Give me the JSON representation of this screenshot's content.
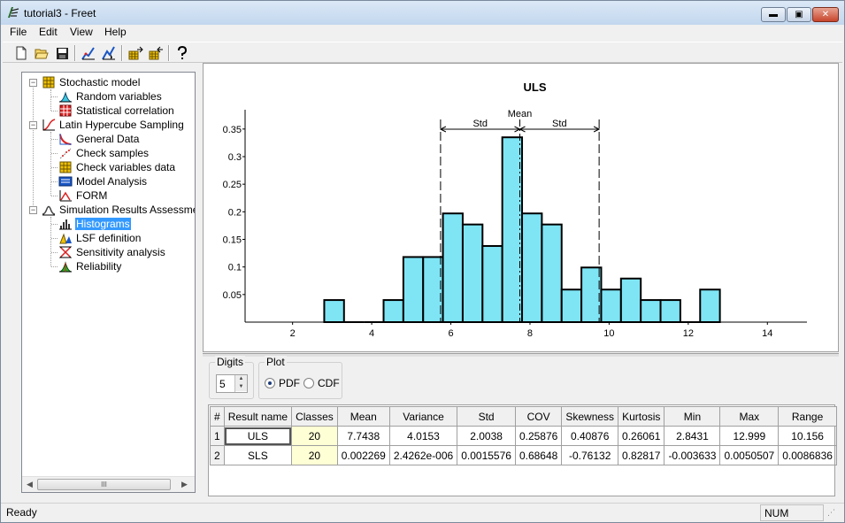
{
  "window": {
    "title": "tutorial3 - Freet",
    "minimize_glyph": "▬",
    "maximize_glyph": "▣",
    "close_glyph": "✕"
  },
  "menu": [
    "File",
    "Edit",
    "View",
    "Help"
  ],
  "toolbar": {
    "icons": [
      "new-file-icon",
      "open-folder-icon",
      "save-icon",
      "chart-up-icon",
      "chart-cursor-icon",
      "grid-export-icon",
      "grid-import-icon",
      "help-icon"
    ]
  },
  "tree": {
    "items": [
      {
        "label": "Stochastic model",
        "level": 0,
        "icon": "stochastic-model-icon",
        "expanded": true
      },
      {
        "label": "Random variables",
        "level": 1,
        "icon": "random-variables-icon"
      },
      {
        "label": "Statistical correlation",
        "level": 1,
        "icon": "correlation-matrix-icon"
      },
      {
        "label": "Latin Hypercube Sampling",
        "level": 0,
        "icon": "lhs-icon",
        "expanded": true
      },
      {
        "label": "General Data",
        "level": 1,
        "icon": "general-data-icon"
      },
      {
        "label": "Check samples",
        "level": 1,
        "icon": "check-samples-icon"
      },
      {
        "label": "Check variables data",
        "level": 1,
        "icon": "check-variables-icon"
      },
      {
        "label": "Model Analysis",
        "level": 1,
        "icon": "model-analysis-icon"
      },
      {
        "label": "FORM",
        "level": 1,
        "icon": "form-icon"
      },
      {
        "label": "Simulation Results Assessment",
        "level": 0,
        "icon": "results-assessment-icon",
        "expanded": true
      },
      {
        "label": "Histograms",
        "level": 1,
        "icon": "histogram-icon",
        "selected": true
      },
      {
        "label": "LSF definition",
        "level": 1,
        "icon": "lsf-icon"
      },
      {
        "label": "Sensitivity analysis",
        "level": 1,
        "icon": "sensitivity-icon"
      },
      {
        "label": "Reliability",
        "level": 1,
        "icon": "reliability-icon"
      }
    ],
    "scrollbar_thumb_glyph": "III"
  },
  "chart_data": {
    "type": "bar",
    "title": "ULS",
    "bar_color": "#7fe5f5",
    "bin_width": 0.5,
    "bins": [
      {
        "x0": 2.8,
        "y": 0.04
      },
      {
        "x0": 3.3,
        "y": 0.0
      },
      {
        "x0": 3.8,
        "y": 0.0
      },
      {
        "x0": 4.3,
        "y": 0.04
      },
      {
        "x0": 4.8,
        "y": 0.118
      },
      {
        "x0": 5.3,
        "y": 0.118
      },
      {
        "x0": 5.8,
        "y": 0.197
      },
      {
        "x0": 6.3,
        "y": 0.177
      },
      {
        "x0": 6.8,
        "y": 0.138
      },
      {
        "x0": 7.3,
        "y": 0.335
      },
      {
        "x0": 7.8,
        "y": 0.197
      },
      {
        "x0": 8.3,
        "y": 0.177
      },
      {
        "x0": 8.8,
        "y": 0.059
      },
      {
        "x0": 9.3,
        "y": 0.099
      },
      {
        "x0": 9.8,
        "y": 0.059
      },
      {
        "x0": 10.3,
        "y": 0.079
      },
      {
        "x0": 10.8,
        "y": 0.04
      },
      {
        "x0": 11.3,
        "y": 0.04
      },
      {
        "x0": 11.8,
        "y": 0.0
      },
      {
        "x0": 12.3,
        "y": 0.059
      }
    ],
    "xlim": [
      0.8,
      15.0
    ],
    "ylim": [
      0,
      0.385
    ],
    "x_ticks": [
      2,
      4,
      6,
      8,
      10,
      12,
      14
    ],
    "y_ticks": [
      0.05,
      0.1,
      0.15,
      0.2,
      0.25,
      0.3,
      0.35
    ],
    "y_tick_labels": [
      "0.05",
      "0.1",
      "0.15",
      "0.2",
      "0.25",
      "0.3",
      "0.35"
    ],
    "mean": 7.7438,
    "std": 2.0038,
    "mean_label": "Mean",
    "std_label": "Std"
  },
  "controls": {
    "digits_label": "Digits",
    "digits_value": "5",
    "plot_label": "Plot",
    "pdf_label": "PDF",
    "cdf_label": "CDF",
    "selected_plot": "PDF"
  },
  "table": {
    "headers": [
      "#",
      "Result name",
      "Classes",
      "Mean",
      "Variance",
      "Std",
      "COV",
      "Skewness",
      "Kurtosis",
      "Min",
      "Max",
      "Range"
    ],
    "rows": [
      [
        "1",
        "ULS",
        "20",
        "7.7438",
        "4.0153",
        "2.0038",
        "0.25876",
        "0.40876",
        "0.26061",
        "2.8431",
        "12.999",
        "10.156"
      ],
      [
        "2",
        "SLS",
        "20",
        "0.002269",
        "2.4262e-006",
        "0.0015576",
        "0.68648",
        "-0.76132",
        "0.82817",
        "-0.003633",
        "0.0050507",
        "0.0086836"
      ]
    ]
  },
  "status": {
    "text": "Ready",
    "num": "NUM"
  }
}
